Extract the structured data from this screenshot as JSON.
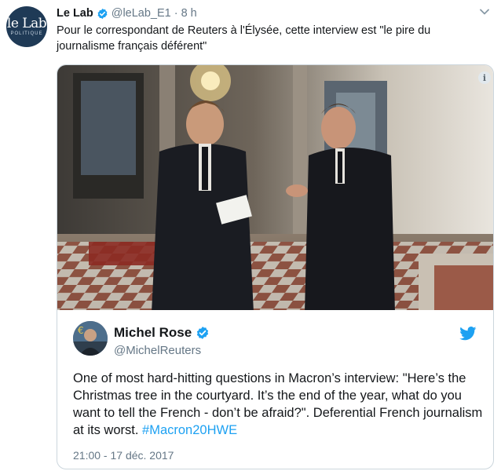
{
  "tweet": {
    "avatar": {
      "line1": "le Lab",
      "line2": "POLITIQUE"
    },
    "display_name": "Le Lab",
    "handle": "@leLab_E1",
    "separator": "·",
    "time": "8 h",
    "text": "Pour le correspondant de Reuters à l'Élysée, cette interview est \"le pire du journalisme français déférent\"",
    "menu_icon": "chevron-down-icon"
  },
  "quoted": {
    "display_name": "Michel Rose",
    "handle": "@MichelReuters",
    "text": "One of most hard-hitting questions in Macron’s interview: \"Here’s the Christmas tree in the courtyard. It’s the end of the year, what do you want to tell the French - don’t be afraid?\". Deferential French journalism at its worst.",
    "hashtag": "#Macron20HWE",
    "timestamp": "21:00 - 17 déc. 2017",
    "source_icon": "twitter-bird-icon",
    "media_info_label": "i"
  },
  "colors": {
    "link": "#1da1f2",
    "secondary_text": "#657786",
    "border": "#ccd6dd",
    "verified": "#1da1f2"
  }
}
